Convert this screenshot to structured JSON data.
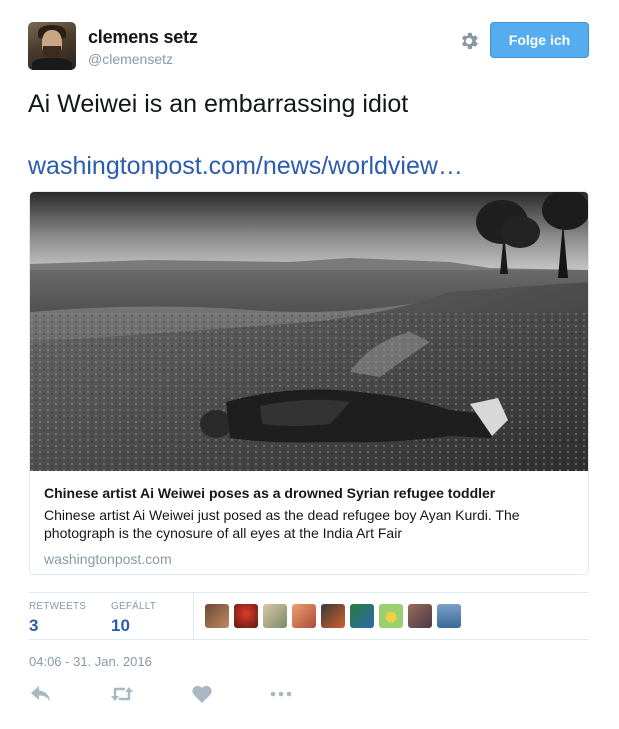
{
  "author": {
    "name": "clemens setz",
    "handle": "@clemensetz"
  },
  "header": {
    "settings_icon": "gear-icon",
    "follow_label": "Folge ich"
  },
  "tweet": {
    "text": "Ai Weiwei is an embarrassing idiot",
    "link": "washingtonpost.com/news/worldview…"
  },
  "card": {
    "title": "Chinese artist Ai Weiwei poses as a drowned Syrian refugee toddler",
    "description": "Chinese artist Ai Weiwei just posed as the dead refugee boy Ayan Kurdi. The photograph is the cynosure of all eyes at the India Art Fair",
    "domain": "washingtonpost.com"
  },
  "stats": {
    "retweets_label": "RETWEETS",
    "retweets_count": "3",
    "likes_label": "GEFÄLLT",
    "likes_count": "10"
  },
  "likers_count_shown": 9,
  "timestamp": "04:06 - 31. Jan. 2016",
  "actions": [
    "reply-icon",
    "retweet-icon",
    "like-icon",
    "more-icon"
  ],
  "colors": {
    "accent": "#55acee",
    "link": "#2b5cad",
    "muted": "#8899a6",
    "border": "#e1e8ed"
  }
}
